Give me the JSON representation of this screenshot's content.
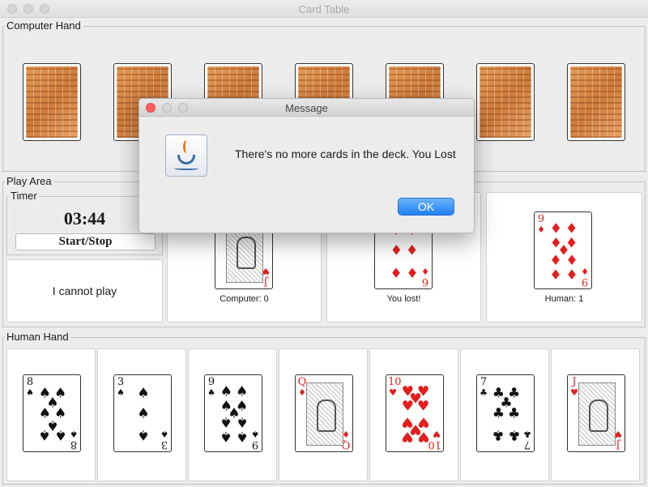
{
  "window": {
    "title": "Card Table"
  },
  "computer_hand": {
    "label": "Computer Hand",
    "card_count": 7
  },
  "play_area": {
    "label": "Play Area",
    "timer": {
      "label": "Timer",
      "value": "03:44",
      "button_label": "Start/Stop"
    },
    "cannot_play_label": "I cannot play",
    "computer_slot": {
      "label": "Computer: 0",
      "card": {
        "rank": "J",
        "suit": "♥",
        "color": "red",
        "face": true
      }
    },
    "result_slot": {
      "label": "You lost!",
      "card": {
        "rank": "6",
        "suit": "♦",
        "color": "red"
      }
    },
    "human_slot": {
      "label": "Human: 1",
      "card": {
        "rank": "9",
        "suit": "♦",
        "color": "red"
      }
    }
  },
  "human_hand": {
    "label": "Human Hand",
    "cards": [
      {
        "rank": "8",
        "suit": "♠",
        "color": "black"
      },
      {
        "rank": "3",
        "suit": "♠",
        "color": "black"
      },
      {
        "rank": "9",
        "suit": "♠",
        "color": "black"
      },
      {
        "rank": "Q",
        "suit": "♦",
        "color": "red",
        "face": true
      },
      {
        "rank": "10",
        "suit": "♥",
        "color": "red"
      },
      {
        "rank": "7",
        "suit": "♣",
        "color": "black"
      },
      {
        "rank": "J",
        "suit": "♥",
        "color": "red",
        "face": true
      }
    ]
  },
  "dialog": {
    "title": "Message",
    "icon": "java-coffee-cup-icon",
    "message": "There's no more cards in the deck. You Lost",
    "ok_label": "OK"
  }
}
